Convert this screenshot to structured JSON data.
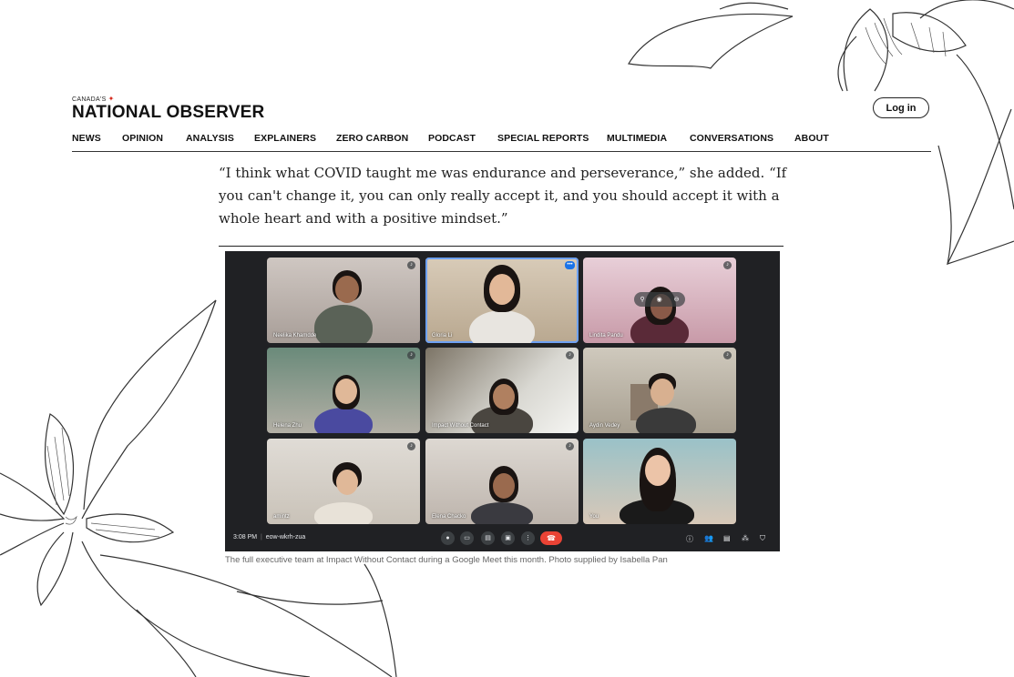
{
  "site": {
    "logo_small": "CANADA'S",
    "logo_main": "NATIONAL OBSERVER",
    "login_label": "Log in"
  },
  "nav": [
    "NEWS",
    "OPINION",
    "ANALYSIS",
    "EXPLAINERS",
    "ZERO CARBON",
    "PODCAST",
    "SPECIAL REPORTS",
    "MULTIMEDIA",
    "CONVERSATIONS",
    "ABOUT"
  ],
  "article": {
    "quote": "“I think what COVID taught me was endurance and perseverance,” she added. “If you can't change it, you can only really accept it, and you should accept it with a whole heart and with a positive mindset.”",
    "caption": "The full executive team at Impact Without Contact during a Google Meet this month. Photo supplied by Isabella Pan"
  },
  "meet": {
    "tiles": [
      {
        "name": "Neelika Khamdde"
      },
      {
        "name": "Gloria Li"
      },
      {
        "name": "Lindita Pandu"
      },
      {
        "name": "Helena Zhu"
      },
      {
        "name": "Impact Without Contact"
      },
      {
        "name": "Aydin Vedey"
      },
      {
        "name": "amintz"
      },
      {
        "name": "Elena Chacko"
      },
      {
        "name": "You"
      }
    ],
    "time": "3:08 PM",
    "meeting_code": "eow-wkrh-zua"
  },
  "colors": {
    "meet_bg": "#202124",
    "end_call": "#ea4335",
    "active_border": "#6ea1f3",
    "canada_red": "#d52b1e"
  },
  "icons": [
    "maple-leaf-icon",
    "mic-icon",
    "camera-icon",
    "captions-icon",
    "present-icon",
    "more-icon",
    "end-call-icon",
    "info-icon",
    "people-icon",
    "chat-icon",
    "activities-icon",
    "host-controls-icon"
  ]
}
